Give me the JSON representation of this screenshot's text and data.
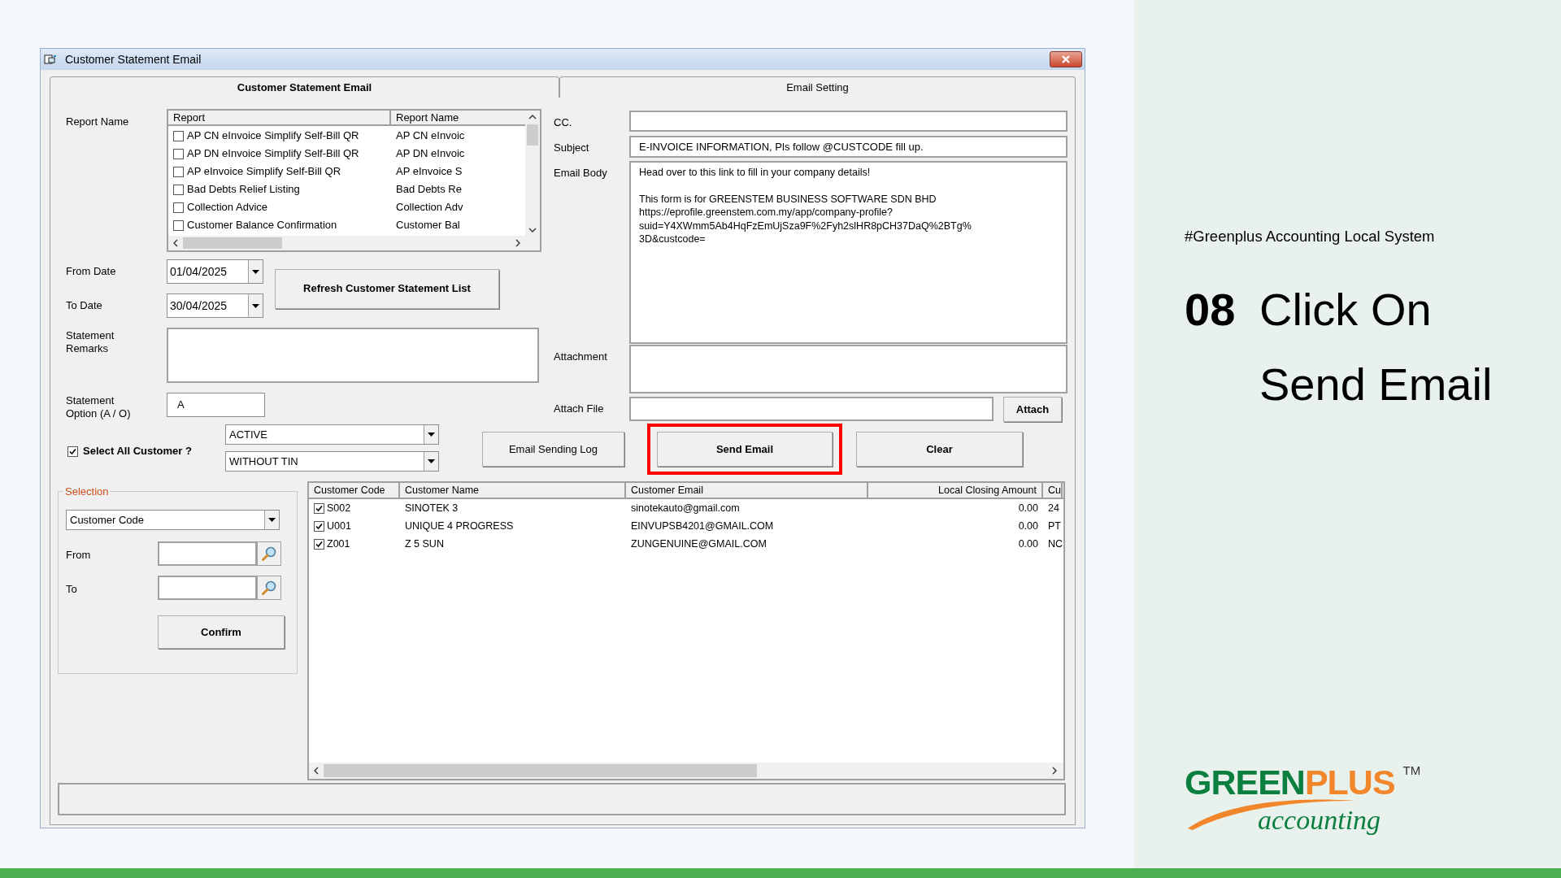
{
  "window": {
    "title": "Customer Statement Email"
  },
  "tabs": [
    {
      "label": "Customer Statement Email",
      "selected": true
    },
    {
      "label": "Email Setting",
      "selected": false
    }
  ],
  "report_list": {
    "label": "Report Name",
    "columns": [
      "Report",
      "Report Name"
    ],
    "rows": [
      {
        "report": "AP CN eInvoice Simplify Self-Bill QR",
        "report_name": "AP CN eInvoic",
        "checked": false
      },
      {
        "report": "AP DN eInvoice Simplify Self-Bill QR",
        "report_name": "AP DN eInvoic",
        "checked": false
      },
      {
        "report": "AP eInvoice Simplify Self-Bill QR",
        "report_name": "AP eInvoice S",
        "checked": false
      },
      {
        "report": "Bad Debts Relief Listing",
        "report_name": "Bad Debts Re",
        "checked": false
      },
      {
        "report": "Collection Advice",
        "report_name": "Collection Adv",
        "checked": false
      },
      {
        "report": "Customer Balance Confirmation",
        "report_name": "Customer Bal",
        "checked": false
      }
    ]
  },
  "from_date": {
    "label": "From Date",
    "value": "01/04/2025"
  },
  "to_date": {
    "label": "To Date",
    "value": "30/04/2025"
  },
  "refresh_button": "Refresh Customer Statement List",
  "statement_remarks": {
    "label": "Statement Remarks"
  },
  "statement_option": {
    "label": "Statement Option (A / O)",
    "value": "A"
  },
  "select_all": {
    "label": "Select All Customer ?",
    "checked": true
  },
  "status_filter": "ACTIVE",
  "tin_filter": "WITHOUT TIN",
  "buttons": [
    {
      "label": "Email Sending Log",
      "bold": false,
      "highlighted": false
    },
    {
      "label": "Send Email",
      "bold": true,
      "highlighted": true
    },
    {
      "label": "Clear",
      "bold": true,
      "highlighted": false
    }
  ],
  "selection": {
    "title": "Selection",
    "field": "Customer Code",
    "from_label": "From",
    "to_label": "To",
    "confirm_button": "Confirm"
  },
  "customers": {
    "columns": [
      "Customer Code",
      "Customer Name",
      "Customer Email",
      "Local Closing Amount",
      "Cu"
    ],
    "rows": [
      {
        "checked": true,
        "code": "S002",
        "name": "SINOTEK 3",
        "email": "sinotekauto@gmail.com",
        "amount": "0.00",
        "column_5": "24"
      },
      {
        "checked": true,
        "code": "U001",
        "name": "UNIQUE 4 PROGRESS",
        "email": "EINVUPSB4201@GMAIL.COM",
        "amount": "0.00",
        "column_5": "PT"
      },
      {
        "checked": true,
        "code": "Z001",
        "name": "Z 5 SUN",
        "email": "ZUNGENUINE@GMAIL.COM",
        "amount": "0.00",
        "column_5": "NC"
      }
    ]
  },
  "email_setting": {
    "cc": {
      "label": "CC."
    },
    "subject": {
      "label": "Subject",
      "value": "E-INVOICE INFORMATION, Pls follow @CUSTCODE fill up."
    },
    "body": {
      "label": "Email Body",
      "paragraphs": [
        "Head over to this link to fill in your company details!",
        "This form is for GREENSTEM BUSINESS SOFTWARE SDN BHD\nhttps://eprofile.greenstem.com.my/app/company-profile?\nsuid=Y4XWmm5Ab4HqFzEmUjSza9F%2Fyh2slHR8pCH37DaQ%2BTg%\n3D&custcode="
      ]
    },
    "attachment": {
      "label": "Attachment"
    },
    "attach_file": {
      "label": "Attach File"
    },
    "attach_button": "Attach"
  },
  "slide": {
    "tag": "#Greenplus Accounting Local System",
    "step": "08",
    "heading_lines": [
      "Click On",
      "Send Email"
    ]
  },
  "logo": {
    "green_word": "GREEN",
    "orange_word": "PLUS",
    "trademark": "TM",
    "tagline": "accounting"
  }
}
